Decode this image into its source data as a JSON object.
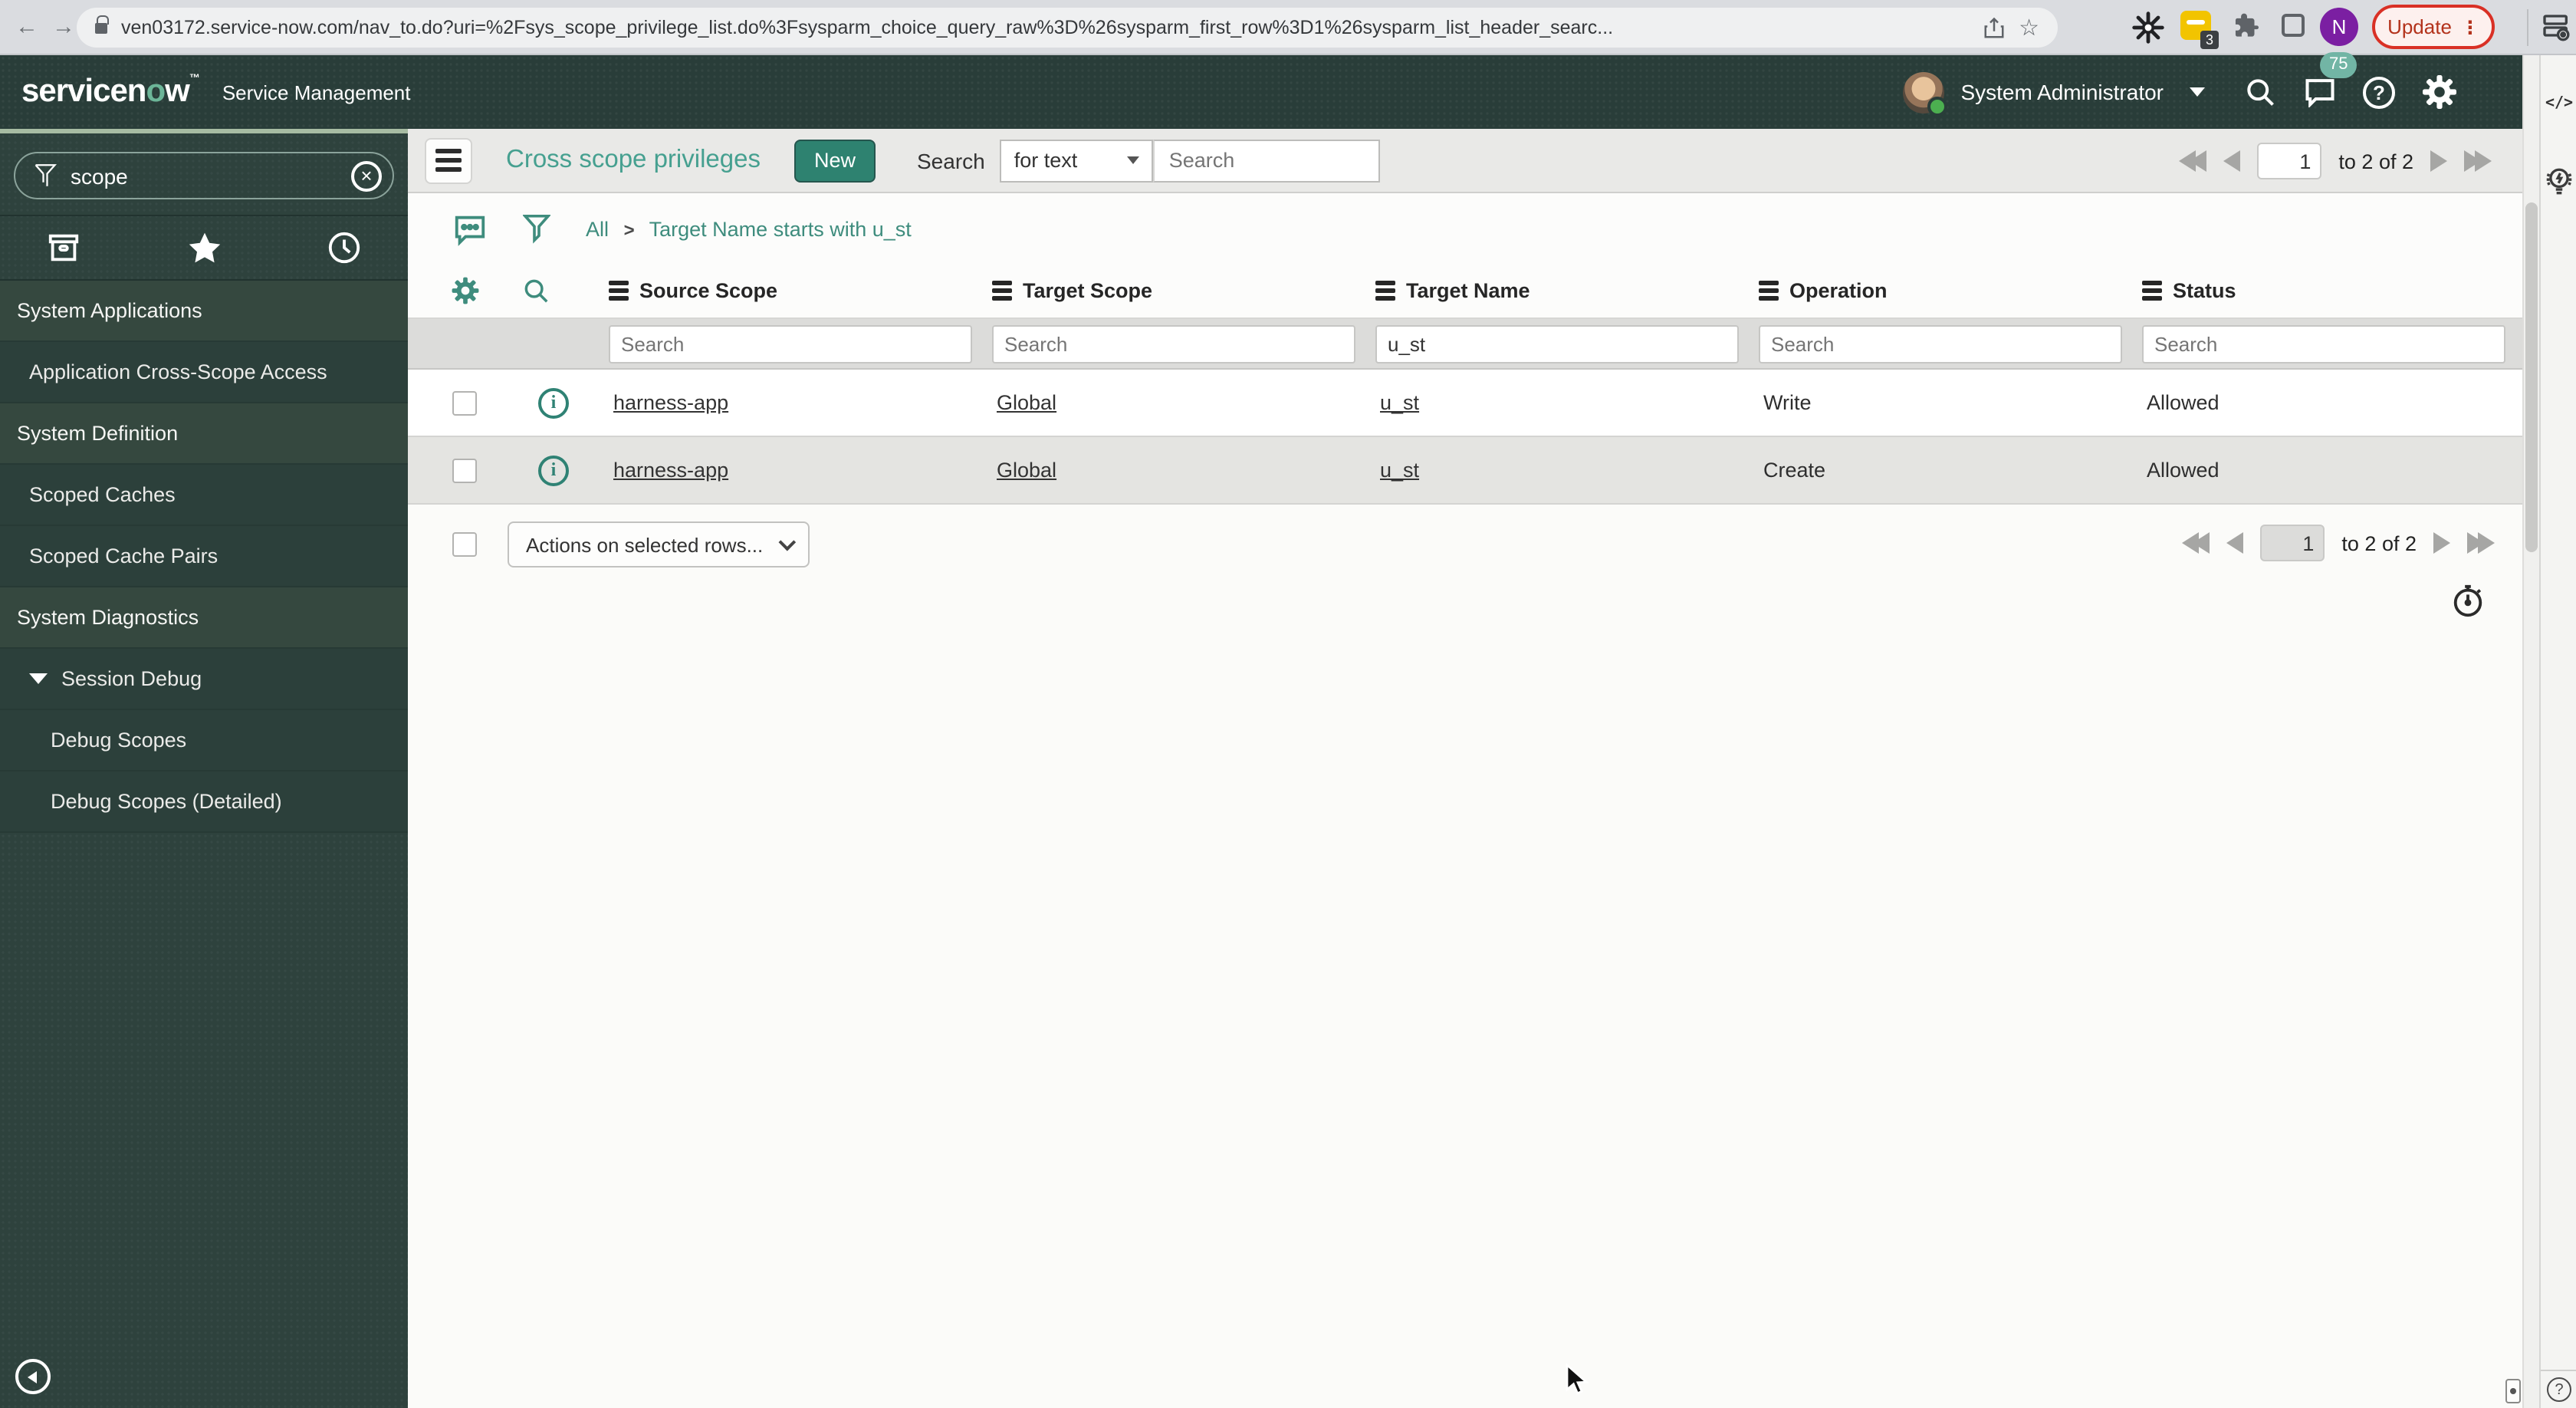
{
  "browser": {
    "url": "ven03172.service-now.com/nav_to.do?uri=%2Fsys_scope_privilege_list.do%3Fsysparm_choice_query_raw%3D%26sysparm_first_row%3D1%26sysparm_list_header_searc...",
    "update_button": "Update",
    "profile_initial": "N",
    "extension_badge": "3"
  },
  "header": {
    "logo_left": "servicen",
    "logo_o": "o",
    "logo_right": "w",
    "logo_tm": "™",
    "product": "Service Management",
    "user": "System Administrator",
    "notification_count": "75",
    "help_glyph": "?"
  },
  "sidebar": {
    "filter_value": "scope",
    "items": [
      {
        "label": "System Applications",
        "type": "header"
      },
      {
        "label": "Application Cross-Scope Access",
        "type": "item"
      },
      {
        "label": "System Definition",
        "type": "header"
      },
      {
        "label": "Scoped Caches",
        "type": "item"
      },
      {
        "label": "Scoped Cache Pairs",
        "type": "item"
      },
      {
        "label": "System Diagnostics",
        "type": "header"
      },
      {
        "label": "Session Debug",
        "type": "expanded-item"
      },
      {
        "label": "Debug Scopes",
        "type": "sub-item"
      },
      {
        "label": "Debug Scopes (Detailed)",
        "type": "sub-item"
      }
    ]
  },
  "toolbar": {
    "title": "Cross scope privileges",
    "new_label": "New",
    "search_label": "Search",
    "search_type": "for text",
    "search_placeholder": "Search"
  },
  "breadcrumb": {
    "root": "All",
    "separator": ">",
    "condition": "Target Name starts with u_st"
  },
  "pagination": {
    "page": "1",
    "range": "to 2 of 2"
  },
  "table": {
    "columns": [
      "Source Scope",
      "Target Scope",
      "Target Name",
      "Operation",
      "Status"
    ],
    "filter_placeholder": "Search",
    "filters": [
      {
        "value": ""
      },
      {
        "value": ""
      },
      {
        "value": "u_st"
      },
      {
        "value": ""
      },
      {
        "value": ""
      }
    ],
    "rows": [
      {
        "source_scope": "harness-app",
        "target_scope": "Global",
        "target_name": "u_st",
        "operation": "Write",
        "status": "Allowed"
      },
      {
        "source_scope": "harness-app",
        "target_scope": "Global",
        "target_name": "u_st",
        "operation": "Create",
        "status": "Allowed"
      }
    ],
    "actions_label": "Actions on selected rows..."
  },
  "right_panel": {
    "code_icon": "</>",
    "help_icon": "?"
  },
  "colors": {
    "accent_teal": "#2e8270",
    "link_teal": "#3e8c7d",
    "banner_bg": "#293d39",
    "sidebar_bg": "#2e423d",
    "notification_badge": "#72b5a5",
    "update_red": "#d93025"
  }
}
